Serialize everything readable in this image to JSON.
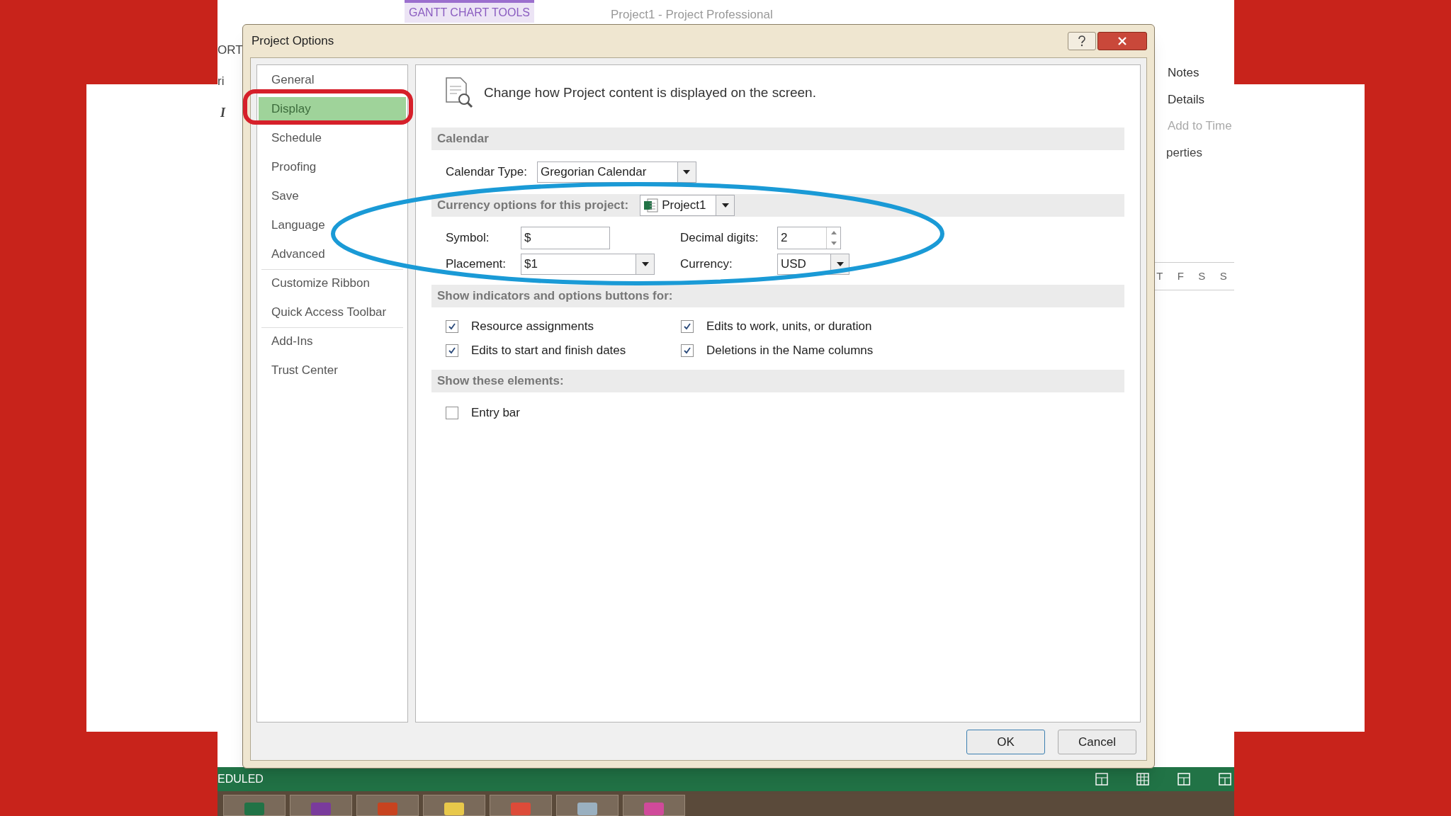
{
  "background_app": {
    "context_tab": "GANTT CHART TOOLS",
    "title": "Project1 - Project Professional",
    "left_fragments": [
      "ORT",
      "ri",
      "I"
    ],
    "right_items": [
      "Notes",
      "Details",
      "Add to Time",
      "perties"
    ],
    "timescale_days": [
      "T",
      "F",
      "S",
      "S"
    ],
    "status_text": "EDULED"
  },
  "dialog": {
    "title": "Project Options",
    "nav_groups": [
      [
        {
          "label": "General",
          "selected": false
        },
        {
          "label": "Display",
          "selected": true
        },
        {
          "label": "Schedule",
          "selected": false
        },
        {
          "label": "Proofing",
          "selected": false
        },
        {
          "label": "Save",
          "selected": false
        },
        {
          "label": "Language",
          "selected": false
        },
        {
          "label": "Advanced",
          "selected": false
        }
      ],
      [
        {
          "label": "Customize Ribbon",
          "selected": false
        },
        {
          "label": "Quick Access Toolbar",
          "selected": false
        }
      ],
      [
        {
          "label": "Add-Ins",
          "selected": false
        },
        {
          "label": "Trust Center",
          "selected": false
        }
      ]
    ],
    "heading": "Change how Project content is displayed on the screen.",
    "calendar": {
      "header": "Calendar",
      "type_label": "Calendar Type:",
      "type_value": "Gregorian Calendar"
    },
    "currency": {
      "header": "Currency options for this project:",
      "project": "Project1",
      "symbol_label": "Symbol:",
      "symbol_value": "$",
      "placement_label": "Placement:",
      "placement_value": "$1",
      "decimal_label": "Decimal digits:",
      "decimal_value": "2",
      "currency_label": "Currency:",
      "currency_value": "USD"
    },
    "indicators": {
      "header": "Show indicators and options buttons for:",
      "options": [
        {
          "label": "Resource assignments",
          "checked": true
        },
        {
          "label": "Edits to work, units, or duration",
          "checked": true
        },
        {
          "label": "Edits to start and finish dates",
          "checked": true
        },
        {
          "label": "Deletions in the Name columns",
          "checked": true
        }
      ]
    },
    "elements": {
      "header": "Show these elements:",
      "options": [
        {
          "label": "Entry bar",
          "checked": false
        }
      ]
    },
    "buttons": [
      "OK",
      "Cancel"
    ]
  }
}
